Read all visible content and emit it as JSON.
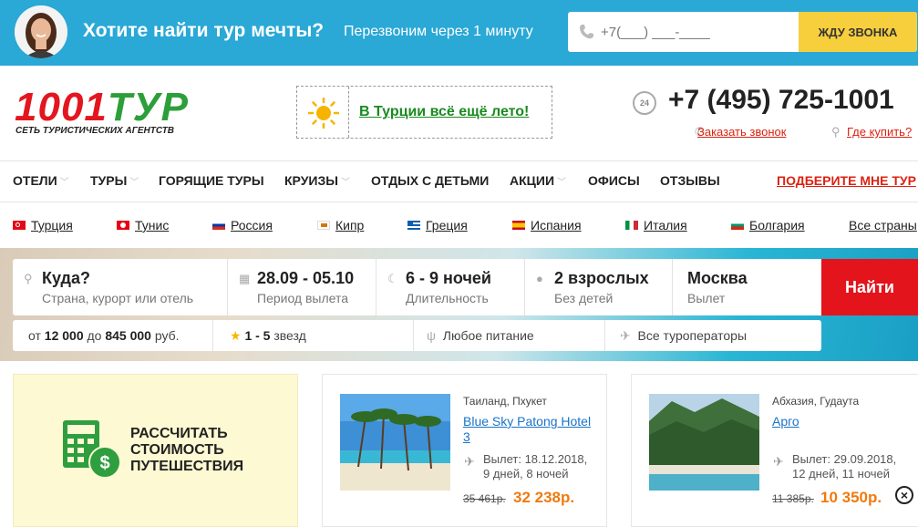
{
  "topbar": {
    "title": "Хотите найти тур мечты?",
    "subtitle": "Перезвоним через 1 минуту",
    "phone_placeholder": "+7(___) ___-____",
    "call_button": "Жду звонка",
    "bg_color": "#2aa8d6",
    "button_color": "#f7cf3d"
  },
  "header": {
    "logo_main_a": "1001",
    "logo_main_b": "ТУР",
    "logo_sub": "СЕТЬ ТУРИСТИЧЕСКИХ АГЕНТСТВ",
    "promo_link": "В Турции всё ещё лето!",
    "badge_24": "24",
    "phone": "+7 (495) 725-1001",
    "order_call": "Заказать звонок",
    "where_buy": "Где купить?"
  },
  "nav": {
    "items": [
      {
        "label": "ОТЕЛИ",
        "dropdown": true
      },
      {
        "label": "ТУРЫ",
        "dropdown": true
      },
      {
        "label": "ГОРЯЩИЕ ТУРЫ",
        "dropdown": false
      },
      {
        "label": "КРУИЗЫ",
        "dropdown": true
      },
      {
        "label": "ОТДЫХ С ДЕТЬМИ",
        "dropdown": false
      },
      {
        "label": "АКЦИИ",
        "dropdown": true
      },
      {
        "label": "ОФИСЫ",
        "dropdown": false
      },
      {
        "label": "ОТЗЫВЫ",
        "dropdown": false
      }
    ],
    "cta": "ПОДБЕРИТЕ МНЕ ТУР"
  },
  "countries": [
    {
      "label": "Турция",
      "flag": "turkey-flag-icon"
    },
    {
      "label": "Тунис",
      "flag": "tunisia-flag-icon"
    },
    {
      "label": "Россия",
      "flag": "russia-flag-icon"
    },
    {
      "label": "Кипр",
      "flag": "cyprus-flag-icon"
    },
    {
      "label": "Греция",
      "flag": "greece-flag-icon"
    },
    {
      "label": "Испания",
      "flag": "spain-flag-icon"
    },
    {
      "label": "Италия",
      "flag": "italy-flag-icon"
    },
    {
      "label": "Болгария",
      "flag": "bulgaria-flag-icon"
    },
    {
      "label": "Все страны",
      "flag": ""
    }
  ],
  "search": {
    "destination": {
      "value": "Куда?",
      "hint": "Страна, курорт или отель"
    },
    "dates": {
      "value": "28.09 - 05.10",
      "hint": "Период вылета"
    },
    "nights": {
      "value": "6 - 9 ночей",
      "hint": "Длительность"
    },
    "people": {
      "value": "2 взрослых",
      "hint": "Без детей"
    },
    "departure": {
      "value": "Москва",
      "hint": "Вылет"
    },
    "find_button": "Найти",
    "button_color": "#e3141b"
  },
  "filters": {
    "price_prefix": "от",
    "price_from": "12 000",
    "price_mid": "до",
    "price_to": "845 000",
    "price_suffix": "руб.",
    "stars": "1 - 5",
    "stars_suffix": "звезд",
    "food": "Любое питание",
    "operators": "Все туроператоры"
  },
  "calc": {
    "line1": "РАССЧИТАТЬ",
    "line2": "СТОИМОСТЬ",
    "line3": "ПУТЕШЕСТВИЯ"
  },
  "tours": [
    {
      "location": "Таиланд, Пхукет",
      "hotel": "Blue Sky Patong Hotel 3",
      "departure_line1": "Вылет: 18.12.2018,",
      "departure_line2": "9 дней, 8 ночей",
      "old_price": "35 461р.",
      "new_price": "32 238р."
    },
    {
      "location": "Абхазия, Гудаута",
      "hotel": "Арго",
      "departure_line1": "Вылет: 29.09.2018,",
      "departure_line2": "12 дней, 11 ночей",
      "old_price": "11 385р.",
      "new_price": "10 350р."
    }
  ],
  "accent_orange": "#f07a10"
}
